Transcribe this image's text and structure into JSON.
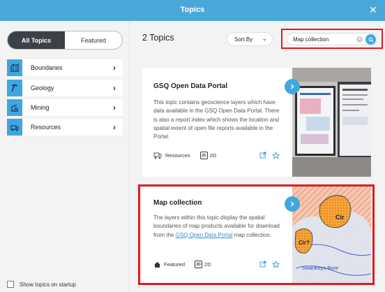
{
  "window": {
    "title": "Topics",
    "close_label": "✕"
  },
  "sidebar": {
    "tabs": [
      {
        "label": "All Topics",
        "active": true
      },
      {
        "label": "Featured",
        "active": false
      }
    ],
    "categories": [
      {
        "label": "Boundaries",
        "icon": "boundaries-icon"
      },
      {
        "label": "Geology",
        "icon": "geology-icon"
      },
      {
        "label": "Mining",
        "icon": "mining-icon"
      },
      {
        "label": "Resources",
        "icon": "resources-icon"
      }
    ],
    "startup_label": "Show topics on startup",
    "startup_checked": false
  },
  "main": {
    "count_label": "2 Topics",
    "sort_label": "Sort By",
    "search": {
      "value": "Map collection",
      "placeholder": ""
    },
    "cards": [
      {
        "title": "GSQ Open Data Portal",
        "description": "This topic contains geoscience layers which have data available in the GSQ Open Data Portal. There is also a report index which shows the location and spatial extent of open file reports available in the Portal.",
        "tag": "Resources",
        "view": "2D"
      },
      {
        "title": "Map collection",
        "description_pre": "The layers within this topic display the spatial boundaries of map products available for download from the ",
        "description_link": "GSQ Open Data Portal",
        "description_post": " map collection.",
        "tag": "Featured",
        "view": "2D",
        "map_labels": [
          "Cir",
          "Cir?",
          "Swankeys Bore"
        ]
      }
    ]
  },
  "colors": {
    "accent": "#3fa7e0",
    "highlight": "#e01b1b",
    "title_bar": "#4aa8d8"
  }
}
